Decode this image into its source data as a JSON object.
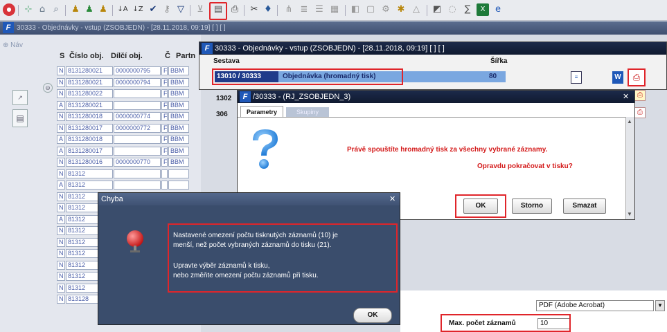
{
  "toolbar": {
    "icons": [
      "stop-icon",
      "new-icon",
      "home-icon",
      "search-icon",
      "user-db-icon",
      "user-db-2-icon",
      "user-db-3-icon",
      "sort-asc-icon",
      "sort-desc-icon",
      "check-icon",
      "key-icon",
      "filter-icon",
      "filter-clear-icon",
      "report-list-icon",
      "print-icon",
      "cut-icon",
      "tag-icon",
      "tree-icon",
      "list-icon",
      "grid-icon",
      "table-icon",
      "chart-icon",
      "doc-icon",
      "gear-icon",
      "triangle-icon",
      "window-icon",
      "help-icon",
      "sigma-icon",
      "excel-icon",
      "ie-icon"
    ]
  },
  "bg_window": {
    "title": "30333 - Objednávky - vstup (ZSOBJEDN) - [28.11.2018, 09:19] [ ] [ ]",
    "nav_label": "Náv"
  },
  "table": {
    "headers": [
      "S",
      "Číslo obj.",
      "Dílčí obj.",
      "Č",
      "Partn"
    ],
    "rows": [
      [
        "N",
        "8131280021",
        "0000000795",
        "F",
        "BBM"
      ],
      [
        "N",
        "8131280021",
        "0000000794",
        "F",
        "BBM"
      ],
      [
        "N",
        "8131280022",
        "",
        "F",
        "BBM"
      ],
      [
        "A",
        "8131280021",
        "",
        "F",
        "BBM"
      ],
      [
        "N",
        "8131280018",
        "0000000774",
        "F",
        "BBM"
      ],
      [
        "N",
        "8131280017",
        "0000000772",
        "F",
        "BBM"
      ],
      [
        "A",
        "8131280018",
        "",
        "F",
        "BBM"
      ],
      [
        "A",
        "8131280017",
        "",
        "F",
        "BBM"
      ],
      [
        "N",
        "8131280016",
        "0000000770",
        "F",
        "BBM"
      ],
      [
        "N",
        "81312",
        "",
        "",
        ""
      ],
      [
        "A",
        "81312",
        "",
        "",
        ""
      ],
      [
        "N",
        "81312",
        "",
        "",
        ""
      ],
      [
        "N",
        "81312",
        "",
        "",
        ""
      ],
      [
        "A",
        "81312",
        "",
        "",
        ""
      ],
      [
        "N",
        "81312",
        "",
        "",
        ""
      ],
      [
        "N",
        "81312",
        "",
        "",
        ""
      ],
      [
        "N",
        "81312",
        "",
        "",
        ""
      ],
      [
        "N",
        "81312",
        "",
        "",
        ""
      ],
      [
        "N",
        "81312",
        "",
        "",
        ""
      ],
      [
        "N",
        "81312",
        "",
        "",
        ""
      ],
      [
        "N",
        "813128",
        "",
        "",
        ""
      ]
    ]
  },
  "report_window": {
    "title": "30333 - Objednávky - vstup (ZSOBJEDN) - [28.11.2018, 09:19] [ ] [ ]",
    "col_sestava": "Sestava",
    "col_sirka": "Šířka",
    "selected_code": "13010 / 30333",
    "selected_name": "Objednávka (hromadný tisk)",
    "selected_width": "80",
    "row2_prefix": "1302",
    "row3_prefix": "306"
  },
  "param_dialog": {
    "title": "/30333 - (RJ_ZSOBJEDN_3)",
    "tab_parametry": "Parametry",
    "tab_other": "Skupiny",
    "message_line1": "Právě spouštíte hromadný tisk za všechny vybrané záznamy.",
    "message_line2": "Opravdu pokračovat v tisku?",
    "ok_label": "OK",
    "storno_label": "Storno",
    "smazat_label": "Smazat",
    "close_glyph": "✕"
  },
  "error_dialog": {
    "title": "Chyba",
    "close_glyph": "✕",
    "line1": "Nastavené omezení počtu tisknutých záznamů (10) je",
    "line2": "menší, než počet vybraných záznamů do tisku (21).",
    "line3": "Upravte výběr záznamů k tisku,",
    "line4": "nebo změňte omezení počtu záznamů při tisku.",
    "ok_label": "OK"
  },
  "print_settings": {
    "format_value": "PDF (Adobe Acrobat)",
    "max_label": "Max. počet záznamů",
    "max_value": "10"
  },
  "colors": {
    "highlight_red": "#e0252a",
    "message_red": "#d41b1b",
    "title_dark": "#101a30",
    "error_bg": "#3a4d6c"
  }
}
